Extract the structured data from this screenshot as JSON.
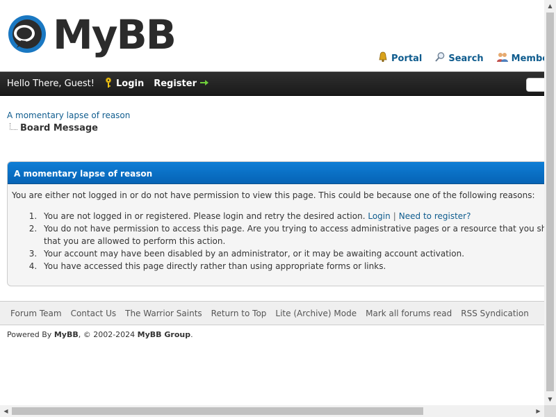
{
  "header": {
    "logo_text": "MyBB",
    "links": [
      {
        "label": "Portal",
        "icon": "portal-bell-icon"
      },
      {
        "label": "Search",
        "icon": "search-icon"
      },
      {
        "label": "Member List",
        "icon": "members-icon"
      }
    ]
  },
  "navbar": {
    "greeting": "Hello There, Guest!",
    "login_label": "Login",
    "register_label": "Register"
  },
  "breadcrumb": {
    "root": "A momentary lapse of reason",
    "current": "Board Message"
  },
  "error": {
    "title": "A momentary lapse of reason",
    "intro": "You are either not logged in or do not have permission to view this page. This could be because one of the following reasons:",
    "reason1": "You are not logged in or registered. Please login and retry the desired action.",
    "reason1_login": "Login",
    "reason1_sep": "|",
    "reason1_register": "Need to register?",
    "reason2_line1": "You do not have permission to access this page. Are you trying to access administrative pages or a resource that you shouldn't be?",
    "reason2_line2": "that you are allowed to perform this action.",
    "reason3": "Your account may have been disabled by an administrator, or it may be awaiting account activation.",
    "reason4": "You have accessed this page directly rather than using appropriate forms or links."
  },
  "footer": {
    "links": [
      "Forum Team",
      "Contact Us",
      "The Warrior Saints",
      "Return to Top",
      "Lite (Archive) Mode",
      "Mark all forums read",
      "RSS Syndication"
    ],
    "powered_prefix": "Powered By ",
    "powered_mybb": "MyBB",
    "powered_mid": ", © 2002-2024 ",
    "powered_group": "MyBB Group",
    "powered_end": "."
  },
  "colors": {
    "link": "#0f5c8e",
    "navbar": "#1f1f1f",
    "error_header": "#0a6fc2"
  }
}
